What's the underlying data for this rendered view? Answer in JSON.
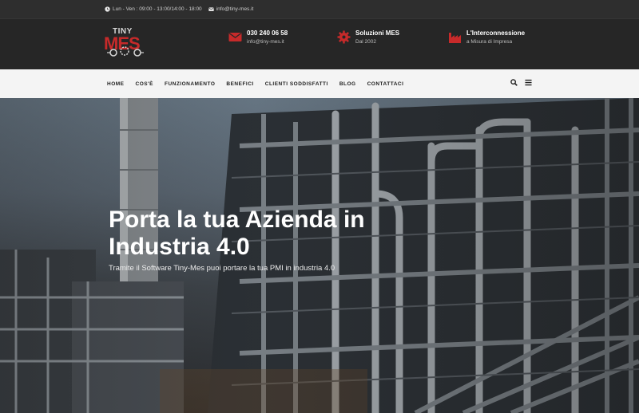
{
  "topbar": {
    "hours": "Lun - Ven : 09:00 - 13:00/14:00 - 18:00",
    "email": "info@tiny-mes.it"
  },
  "logo": {
    "line1": "TINY",
    "line2": "MES"
  },
  "header": {
    "contact": {
      "title": "030 240 06 58",
      "subtitle": "info@tiny-mes.it"
    },
    "solutions": {
      "title": "Soluzioni MES",
      "subtitle": "Dal 2002"
    },
    "interconnection": {
      "title": "L'Interconnessione",
      "subtitle": "a Misura di Impresa"
    }
  },
  "nav": {
    "items": [
      "HOME",
      "COS'È",
      "FUNZIONAMENTO",
      "BENEFICI",
      "CLIENTI SODDISFATTI",
      "BLOG",
      "CONTATTACI"
    ]
  },
  "hero": {
    "title": "Porta la tua Azienda in Industria 4.0",
    "subtitle": "Tramite il Software Tiny-Mes puoi portare la tua PMI in industria 4.0"
  },
  "colors": {
    "accent": "#c72a2a",
    "topbar": "#2e2e2e",
    "header": "#262626",
    "nav": "#f4f4f4"
  }
}
